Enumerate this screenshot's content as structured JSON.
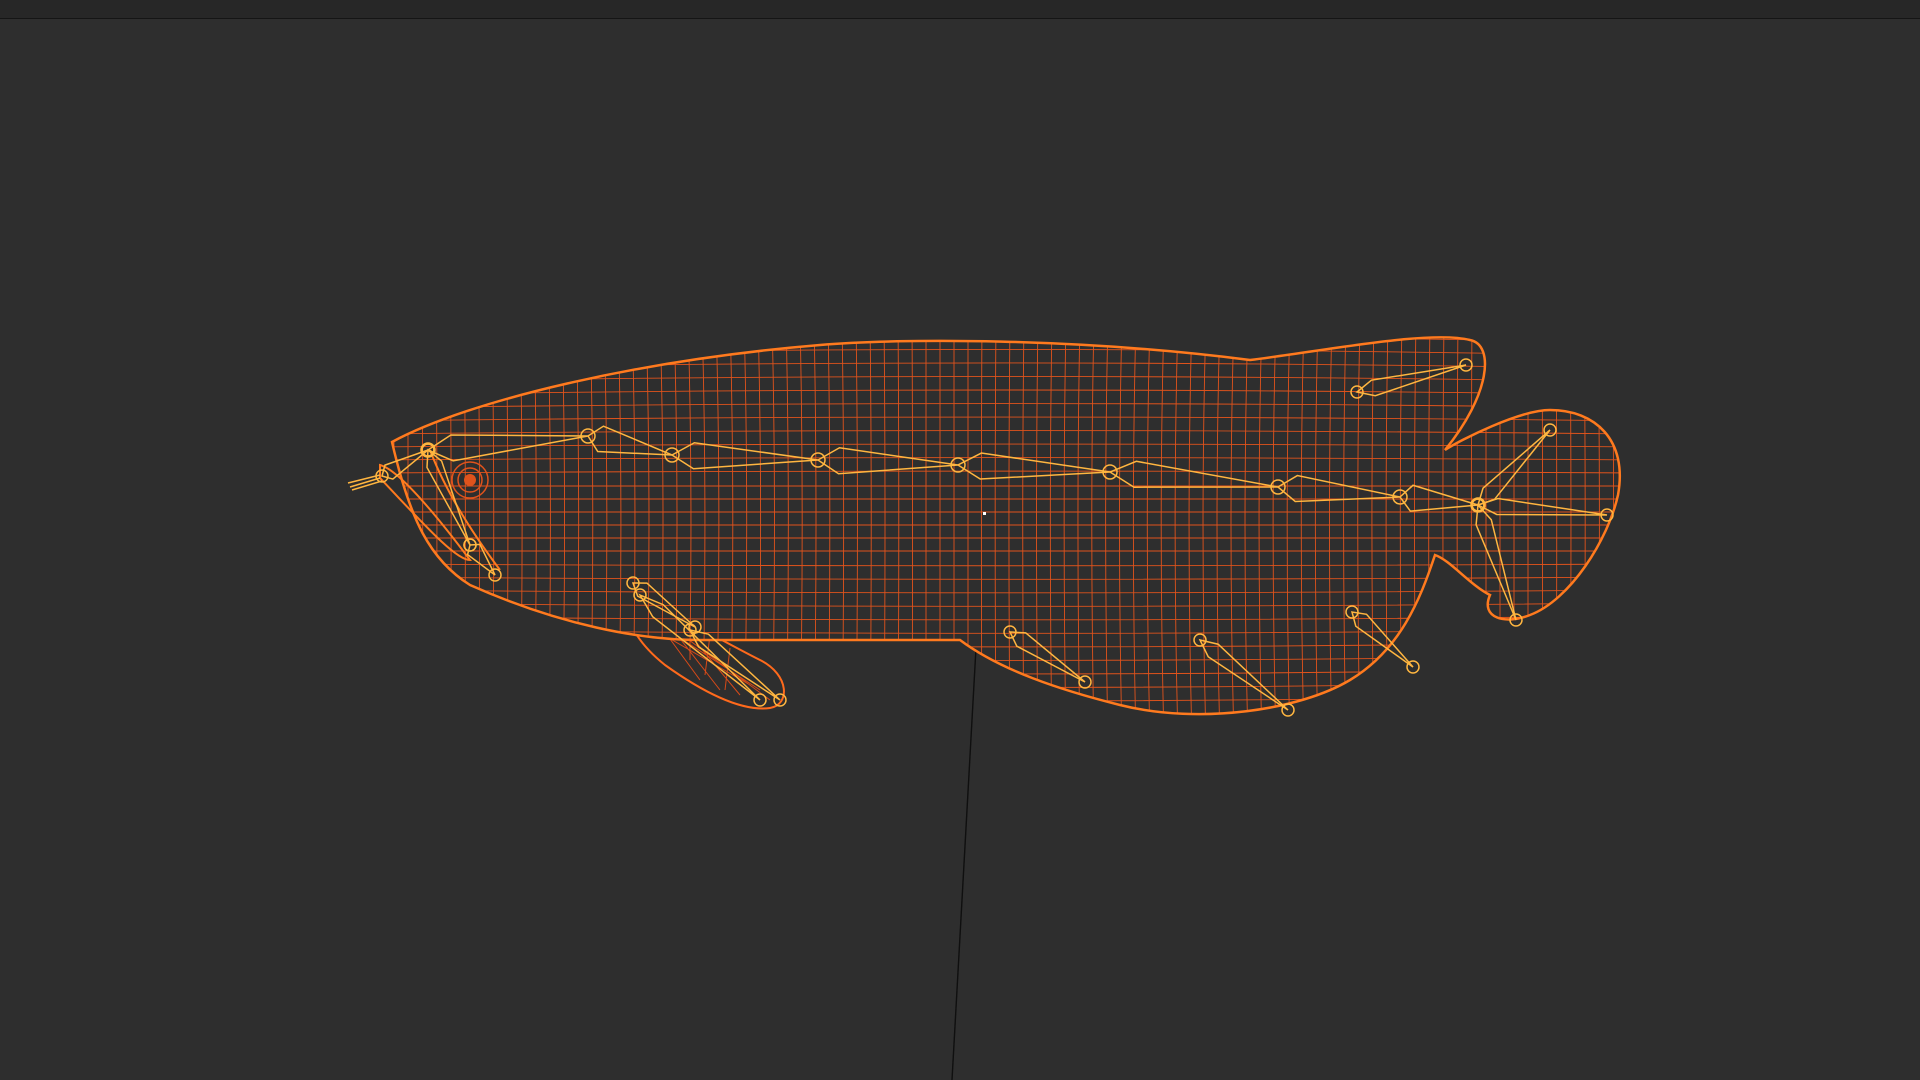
{
  "viewport": {
    "background_color": "#2e2e2e",
    "mode": "wireframe"
  },
  "model": {
    "type": "fish-mesh",
    "selected": true,
    "wire_color": "#e0531c",
    "outline_color": "#ff7a1e"
  },
  "rig": {
    "bone_color": "#ffb640",
    "spine_joint_count": 9
  },
  "icons": {
    "pivot": "origin-dot-icon",
    "eye": "eye-target-icon"
  }
}
